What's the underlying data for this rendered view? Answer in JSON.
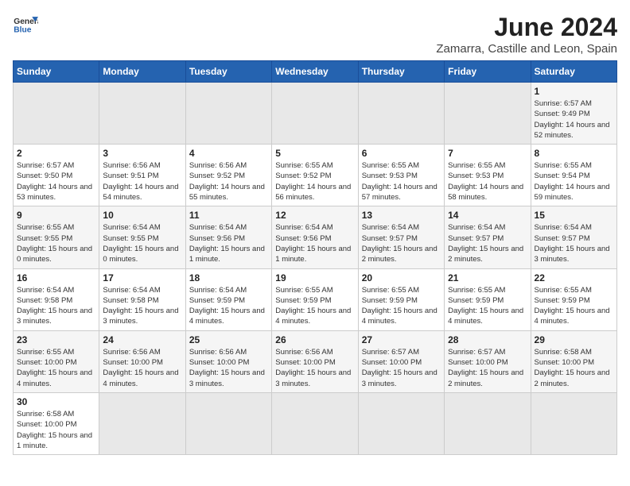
{
  "header": {
    "logo_general": "General",
    "logo_blue": "Blue",
    "month_year": "June 2024",
    "location": "Zamarra, Castille and Leon, Spain"
  },
  "weekdays": [
    "Sunday",
    "Monday",
    "Tuesday",
    "Wednesday",
    "Thursday",
    "Friday",
    "Saturday"
  ],
  "weeks": [
    [
      null,
      null,
      null,
      null,
      null,
      null,
      {
        "day": "1",
        "sunrise": "6:57 AM",
        "sunset": "9:49 PM",
        "daylight": "14 hours and 52 minutes."
      }
    ],
    [
      {
        "day": "2",
        "sunrise": "6:57 AM",
        "sunset": "9:50 PM",
        "daylight": "14 hours and 53 minutes."
      },
      {
        "day": "3",
        "sunrise": "6:56 AM",
        "sunset": "9:51 PM",
        "daylight": "14 hours and 54 minutes."
      },
      {
        "day": "4",
        "sunrise": "6:56 AM",
        "sunset": "9:52 PM",
        "daylight": "14 hours and 55 minutes."
      },
      {
        "day": "5",
        "sunrise": "6:55 AM",
        "sunset": "9:52 PM",
        "daylight": "14 hours and 56 minutes."
      },
      {
        "day": "6",
        "sunrise": "6:55 AM",
        "sunset": "9:53 PM",
        "daylight": "14 hours and 57 minutes."
      },
      {
        "day": "7",
        "sunrise": "6:55 AM",
        "sunset": "9:53 PM",
        "daylight": "14 hours and 58 minutes."
      },
      {
        "day": "8",
        "sunrise": "6:55 AM",
        "sunset": "9:54 PM",
        "daylight": "14 hours and 59 minutes."
      }
    ],
    [
      {
        "day": "9",
        "sunrise": "6:55 AM",
        "sunset": "9:55 PM",
        "daylight": "15 hours and 0 minutes."
      },
      {
        "day": "10",
        "sunrise": "6:54 AM",
        "sunset": "9:55 PM",
        "daylight": "15 hours and 0 minutes."
      },
      {
        "day": "11",
        "sunrise": "6:54 AM",
        "sunset": "9:56 PM",
        "daylight": "15 hours and 1 minute."
      },
      {
        "day": "12",
        "sunrise": "6:54 AM",
        "sunset": "9:56 PM",
        "daylight": "15 hours and 1 minute."
      },
      {
        "day": "13",
        "sunrise": "6:54 AM",
        "sunset": "9:57 PM",
        "daylight": "15 hours and 2 minutes."
      },
      {
        "day": "14",
        "sunrise": "6:54 AM",
        "sunset": "9:57 PM",
        "daylight": "15 hours and 2 minutes."
      },
      {
        "day": "15",
        "sunrise": "6:54 AM",
        "sunset": "9:57 PM",
        "daylight": "15 hours and 3 minutes."
      }
    ],
    [
      {
        "day": "16",
        "sunrise": "6:54 AM",
        "sunset": "9:58 PM",
        "daylight": "15 hours and 3 minutes."
      },
      {
        "day": "17",
        "sunrise": "6:54 AM",
        "sunset": "9:58 PM",
        "daylight": "15 hours and 3 minutes."
      },
      {
        "day": "18",
        "sunrise": "6:54 AM",
        "sunset": "9:59 PM",
        "daylight": "15 hours and 4 minutes."
      },
      {
        "day": "19",
        "sunrise": "6:55 AM",
        "sunset": "9:59 PM",
        "daylight": "15 hours and 4 minutes."
      },
      {
        "day": "20",
        "sunrise": "6:55 AM",
        "sunset": "9:59 PM",
        "daylight": "15 hours and 4 minutes."
      },
      {
        "day": "21",
        "sunrise": "6:55 AM",
        "sunset": "9:59 PM",
        "daylight": "15 hours and 4 minutes."
      },
      {
        "day": "22",
        "sunrise": "6:55 AM",
        "sunset": "9:59 PM",
        "daylight": "15 hours and 4 minutes."
      }
    ],
    [
      {
        "day": "23",
        "sunrise": "6:55 AM",
        "sunset": "10:00 PM",
        "daylight": "15 hours and 4 minutes."
      },
      {
        "day": "24",
        "sunrise": "6:56 AM",
        "sunset": "10:00 PM",
        "daylight": "15 hours and 4 minutes."
      },
      {
        "day": "25",
        "sunrise": "6:56 AM",
        "sunset": "10:00 PM",
        "daylight": "15 hours and 3 minutes."
      },
      {
        "day": "26",
        "sunrise": "6:56 AM",
        "sunset": "10:00 PM",
        "daylight": "15 hours and 3 minutes."
      },
      {
        "day": "27",
        "sunrise": "6:57 AM",
        "sunset": "10:00 PM",
        "daylight": "15 hours and 3 minutes."
      },
      {
        "day": "28",
        "sunrise": "6:57 AM",
        "sunset": "10:00 PM",
        "daylight": "15 hours and 2 minutes."
      },
      {
        "day": "29",
        "sunrise": "6:58 AM",
        "sunset": "10:00 PM",
        "daylight": "15 hours and 2 minutes."
      }
    ],
    [
      {
        "day": "30",
        "sunrise": "6:58 AM",
        "sunset": "10:00 PM",
        "daylight": "15 hours and 1 minute."
      },
      null,
      null,
      null,
      null,
      null,
      null
    ]
  ]
}
